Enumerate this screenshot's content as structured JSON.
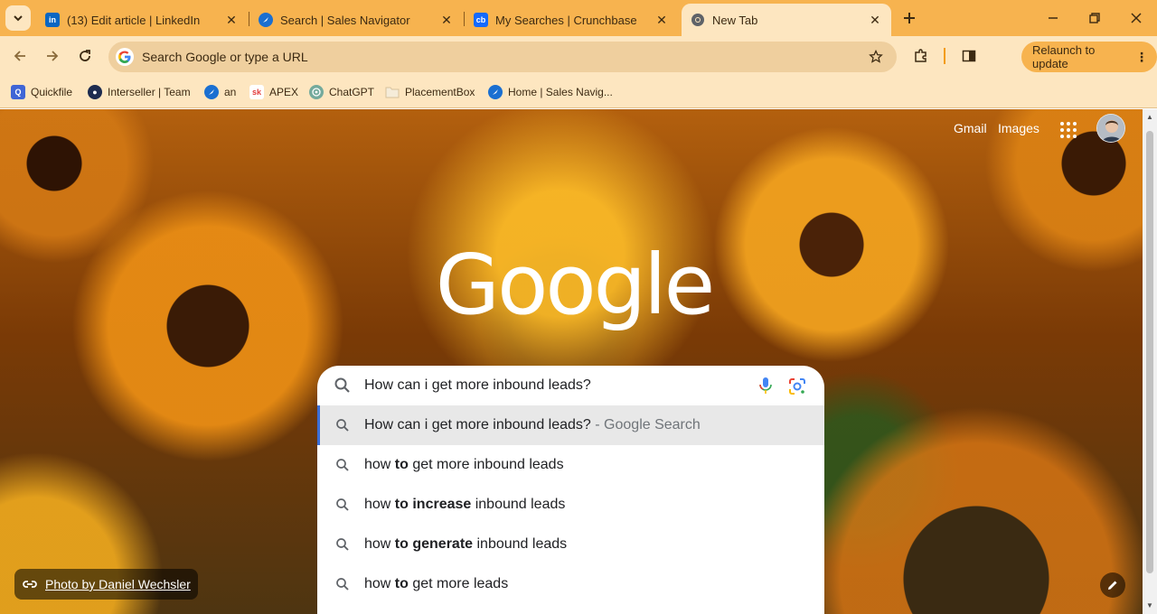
{
  "tabs": [
    {
      "title": "(13) Edit article | LinkedIn",
      "favicon": "linkedin-icon",
      "color": "#0a66c2",
      "glyph": "in",
      "active": false
    },
    {
      "title": "Search | Sales Navigator",
      "favicon": "sales-navigator-icon",
      "color": "#1a6fd1",
      "glyph": "",
      "active": false
    },
    {
      "title": "My Searches | Crunchbase",
      "favicon": "crunchbase-icon",
      "color": "#146aff",
      "glyph": "cb",
      "active": false
    },
    {
      "title": "New Tab",
      "favicon": "chrome-icon",
      "color": "#5f6368",
      "glyph": "",
      "active": true
    }
  ],
  "toolbar": {
    "omnibox_placeholder": "Search Google or type a URL",
    "relaunch_label": "Relaunch to update"
  },
  "bookmarks": [
    {
      "label": "Quickfile",
      "icon": "quickfile-icon",
      "color": "#3f65d6",
      "glyph": "Q"
    },
    {
      "label": "Interseller | Team",
      "icon": "interseller-icon",
      "color": "#1d2b4f",
      "glyph": "●"
    },
    {
      "label": "an",
      "icon": "sales-navigator-icon",
      "color": "#1a6fd1",
      "glyph": ""
    },
    {
      "label": "APEX",
      "icon": "apex-icon",
      "color": "#ffffff",
      "glyph": "sk"
    },
    {
      "label": "ChatGPT",
      "icon": "chatgpt-icon",
      "color": "#74aa9c",
      "glyph": ""
    },
    {
      "label": "PlacementBox",
      "icon": "folder-icon",
      "color": "#f5e6c8",
      "glyph": ""
    },
    {
      "label": "Home | Sales Navig...",
      "icon": "sales-navigator-icon",
      "color": "#1a6fd1",
      "glyph": ""
    }
  ],
  "ntp": {
    "gmail": "Gmail",
    "images": "Images",
    "logo": "Google",
    "photo_credit": "Photo by Daniel Wechsler"
  },
  "search": {
    "query": "How can i get more inbound leads?",
    "suggestions": [
      {
        "parts": [
          {
            "t": "How can i get more inbound leads?",
            "b": false
          }
        ],
        "suffix": " - Google Search",
        "selected": true
      },
      {
        "parts": [
          {
            "t": "how ",
            "b": false
          },
          {
            "t": "to",
            "b": true
          },
          {
            "t": " get more inbound leads",
            "b": false
          }
        ],
        "suffix": "",
        "selected": false
      },
      {
        "parts": [
          {
            "t": "how ",
            "b": false
          },
          {
            "t": "to increase",
            "b": true
          },
          {
            "t": " inbound leads",
            "b": false
          }
        ],
        "suffix": "",
        "selected": false
      },
      {
        "parts": [
          {
            "t": "how ",
            "b": false
          },
          {
            "t": "to generate",
            "b": true
          },
          {
            "t": " inbound leads",
            "b": false
          }
        ],
        "suffix": "",
        "selected": false
      },
      {
        "parts": [
          {
            "t": "how ",
            "b": false
          },
          {
            "t": "to",
            "b": true
          },
          {
            "t": " get more leads",
            "b": false
          }
        ],
        "suffix": "",
        "selected": false
      }
    ]
  },
  "colors": {
    "tabstrip": "#f7b34f",
    "toolbar": "#fde6c0",
    "accent_blue": "#3b6fd8"
  }
}
